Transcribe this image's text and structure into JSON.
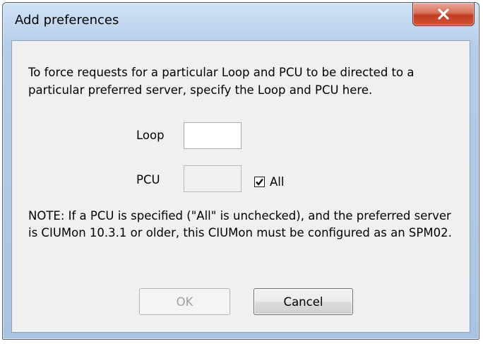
{
  "window": {
    "title": "Add preferences",
    "close_icon": "close-icon"
  },
  "dialog": {
    "instructions": "To force requests for a particular Loop and PCU to be directed to a particular preferred server, specify the Loop and PCU here.",
    "loop_label": "Loop",
    "loop_value": "",
    "pcu_label": "PCU",
    "pcu_value": "",
    "all_label": "All",
    "all_checked": true,
    "note": "NOTE: If a PCU is specified (\"All\" is unchecked), and the preferred server is CIUMon 10.3.1 or older, this CIUMon must be configured as an SPM02.",
    "ok_label": "OK",
    "cancel_label": "Cancel"
  },
  "colors": {
    "close_button": "#c23a1f",
    "frame": "#b4cde8",
    "client_background": "#f0f0f0"
  }
}
